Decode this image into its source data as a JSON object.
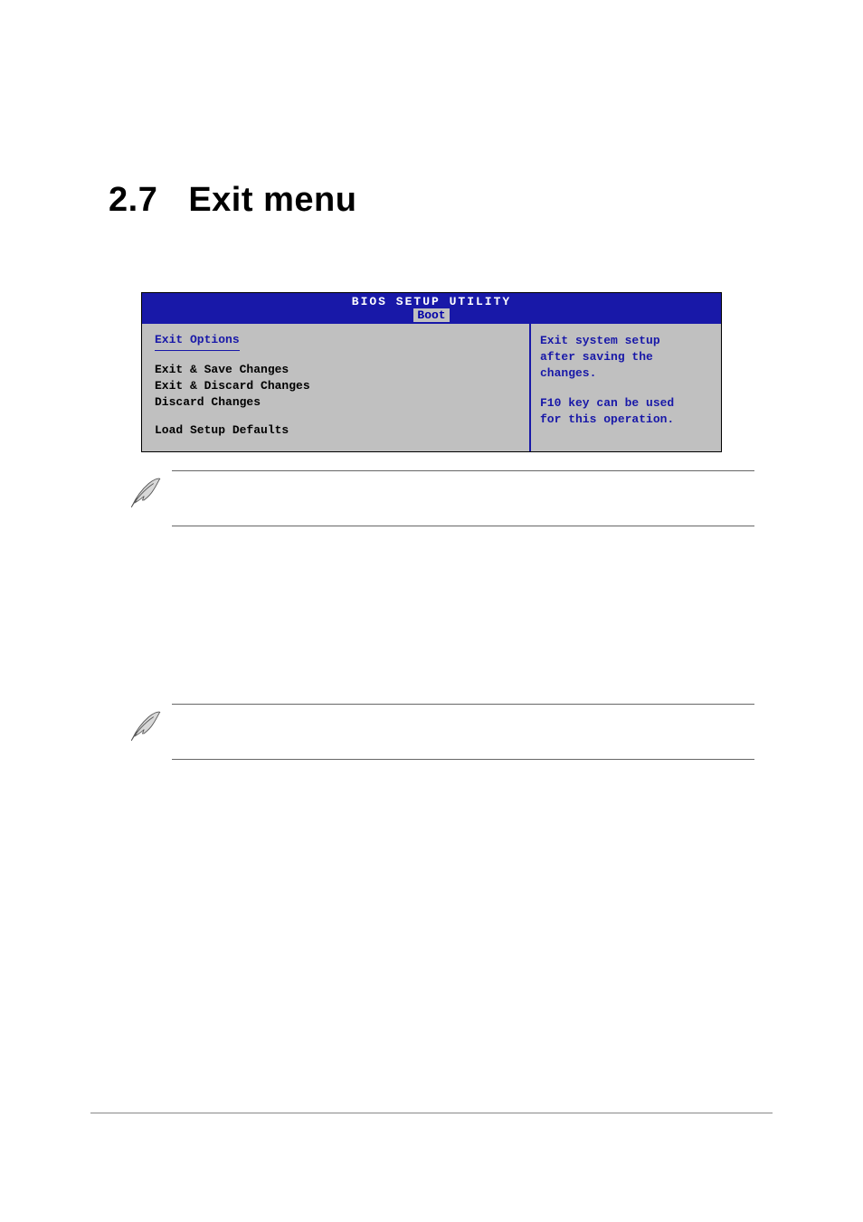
{
  "heading": {
    "number": "2.7",
    "title": "Exit menu"
  },
  "bios": {
    "title": "BIOS SETUP UTILITY",
    "tab": "Boot",
    "left": {
      "heading": "Exit Options",
      "items": [
        "Exit & Save Changes",
        "Exit & Discard Changes",
        "Discard Changes"
      ],
      "last": "Load Setup Defaults"
    },
    "right": {
      "line1": "Exit system setup",
      "line2": "after saving the",
      "line3": "changes.",
      "line4": "F10 key can be used",
      "line5": "for this operation."
    }
  }
}
